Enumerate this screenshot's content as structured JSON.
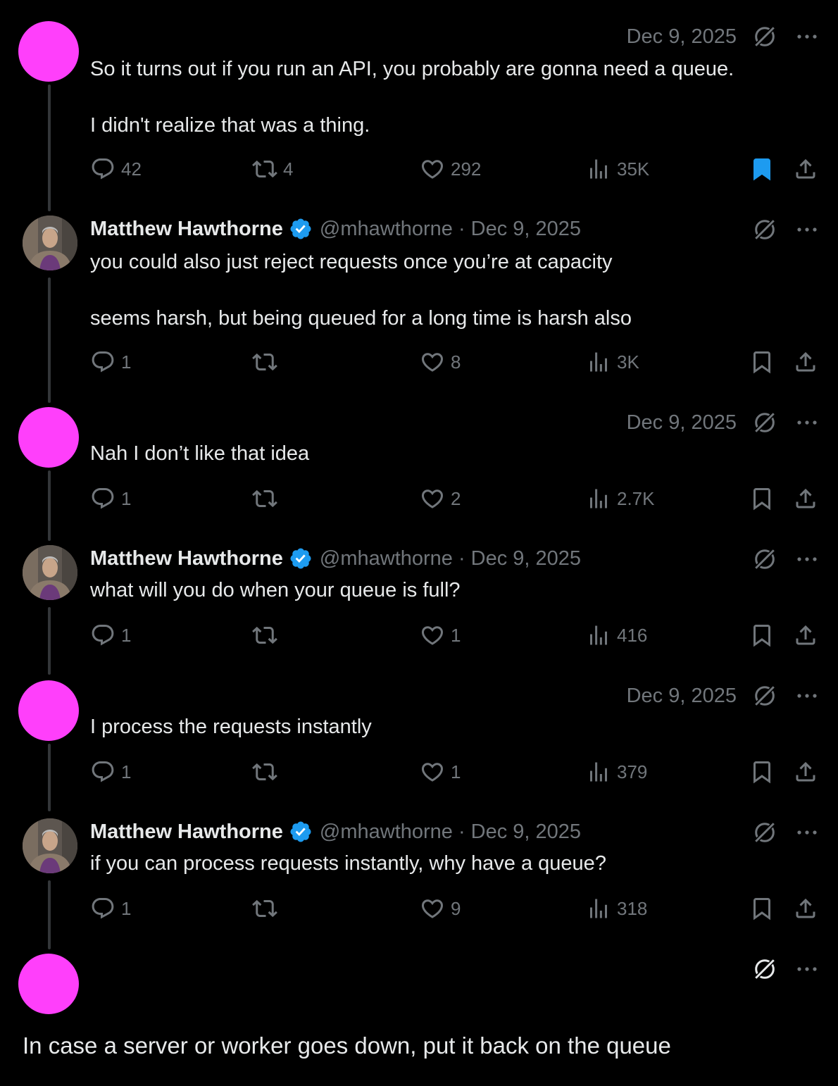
{
  "colors": {
    "background": "#000000",
    "text": "#e7e9ea",
    "muted": "#71767b",
    "verified": "#1d9bf0",
    "bookmark_active": "#1d9bf0",
    "blank_avatar": "#ff3ffb"
  },
  "tweets": [
    {
      "author": "",
      "date": "Dec 9, 2025",
      "text": "So it turns out if you run an API, you probably are gonna need a queue.\n\nI didn't realize that was a thing.",
      "replies": "42",
      "retweets": "4",
      "likes": "292",
      "views": "35K",
      "bookmarked": true
    },
    {
      "author": "Matthew Hawthorne",
      "handle": "@mhawthorne",
      "date": "· Dec 9, 2025",
      "text": "you could also just reject requests once you’re at capacity\n\nseems harsh, but being queued for a long time is harsh also",
      "replies": "1",
      "retweets": "",
      "likes": "8",
      "views": "3K"
    },
    {
      "author": "",
      "date": "Dec 9, 2025",
      "text": "Nah I don’t like that idea",
      "replies": "1",
      "retweets": "",
      "likes": "2",
      "views": "2.7K"
    },
    {
      "author": "Matthew Hawthorne",
      "handle": "@mhawthorne",
      "date": "· Dec 9, 2025",
      "text": "what will you do when your queue is full?",
      "replies": "1",
      "retweets": "",
      "likes": "1",
      "views": "416"
    },
    {
      "author": "",
      "date": "Dec 9, 2025",
      "text": "I process the requests instantly",
      "replies": "1",
      "retweets": "",
      "likes": "1",
      "views": "379"
    },
    {
      "author": "Matthew Hawthorne",
      "handle": "@mhawthorne",
      "date": "· Dec 9, 2025",
      "text": "if you can process requests instantly, why have a queue?",
      "replies": "1",
      "retweets": "",
      "likes": "9",
      "views": "318"
    }
  ],
  "final_reply": {
    "text": "In case a server or worker goes down, put it back on the queue"
  },
  "icons": [
    "grok-icon",
    "more-icon",
    "verified-icon",
    "reply-icon",
    "retweet-icon",
    "like-icon",
    "views-icon",
    "bookmark-icon",
    "share-icon"
  ]
}
